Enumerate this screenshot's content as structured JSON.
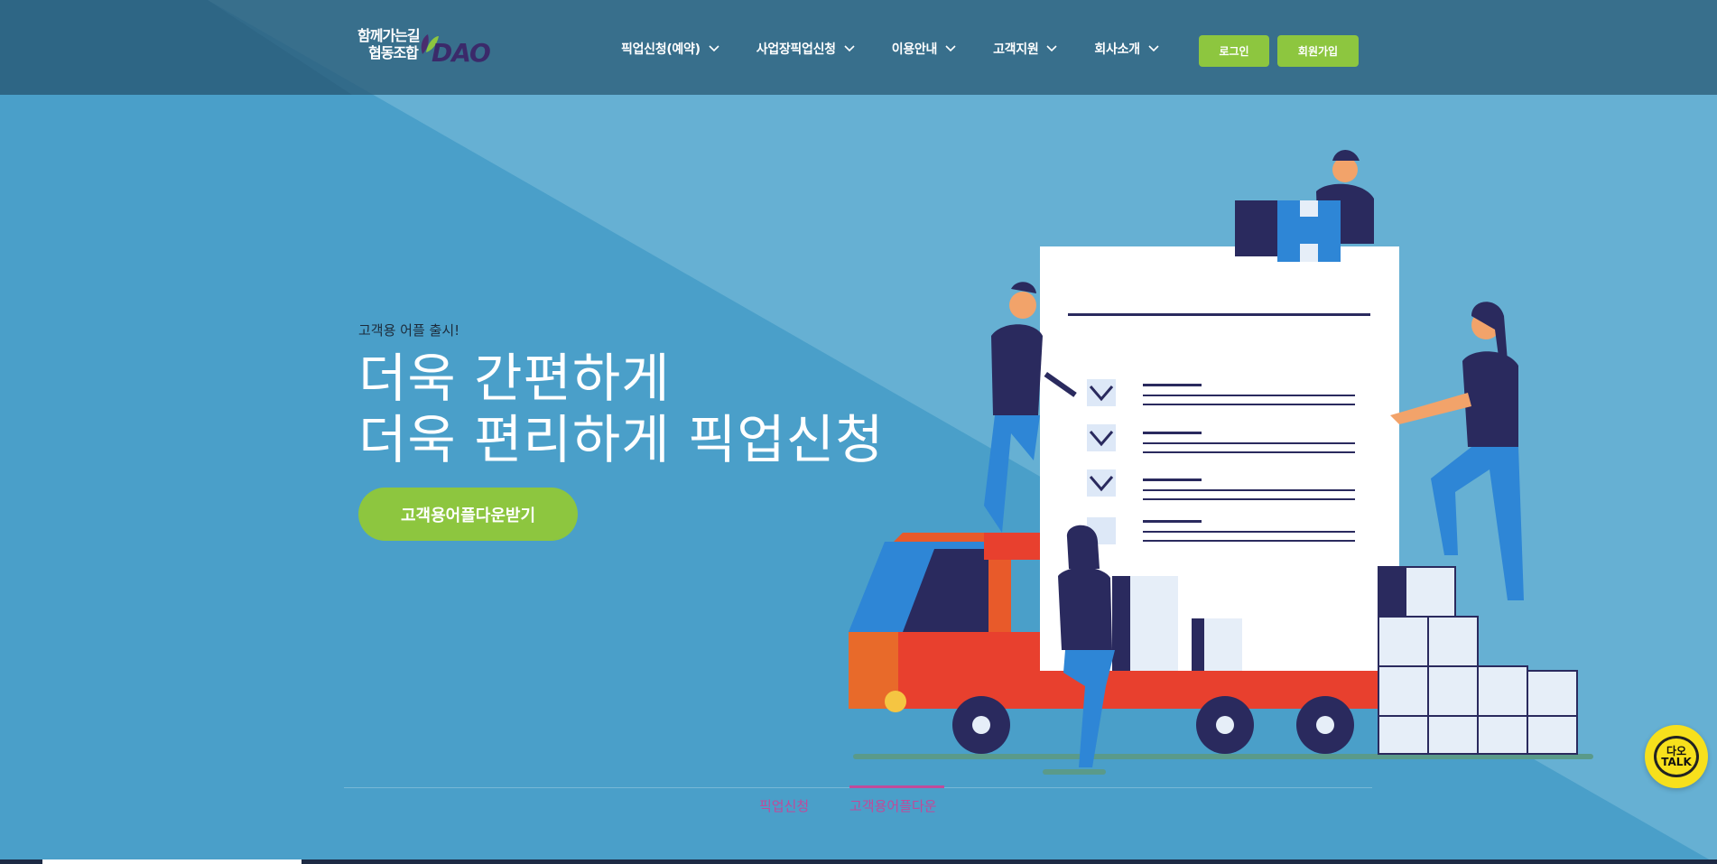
{
  "colors": {
    "bg_blue": "#4aa0c8",
    "header": "#2c5c78",
    "green": "#8dc63f",
    "tab_active": "#c04a9a",
    "talk_yellow": "#f7e01c"
  },
  "logo": {
    "line1": "함께가는길",
    "line2": "협동조합",
    "brand": "DAO",
    "icon": "leaf-icon"
  },
  "nav": {
    "items": [
      {
        "label": "픽업신청(예약)",
        "icon": "chevron-down-icon"
      },
      {
        "label": "사업장픽업신청",
        "icon": "chevron-down-icon"
      },
      {
        "label": "이용안내",
        "icon": "chevron-down-icon"
      },
      {
        "label": "고객지원",
        "icon": "chevron-down-icon"
      },
      {
        "label": "회사소개",
        "icon": "chevron-down-icon"
      }
    ],
    "login_label": "로그인",
    "join_label": "회원가입"
  },
  "hero": {
    "subtitle": "고객용 어플 출시!",
    "title_line1": "더욱 간편하게",
    "title_line2": "더욱 편리하게 픽업신청",
    "cta_label": "고객용어플다운받기"
  },
  "tabs": [
    {
      "label": "픽업신청"
    },
    {
      "label": "고객용어플다운"
    }
  ],
  "talk": {
    "line1": "다오",
    "line2": "TALK"
  }
}
